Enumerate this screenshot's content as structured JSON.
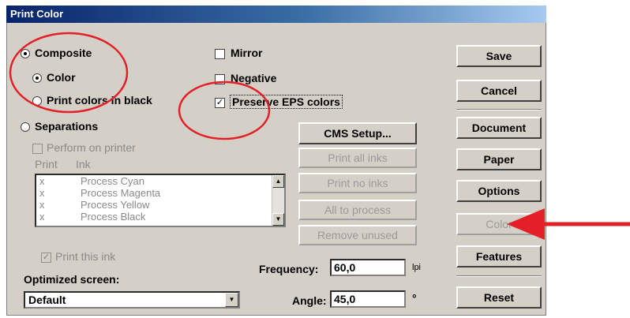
{
  "title": "Print Color",
  "options": {
    "composite": {
      "label": "Composite",
      "selected": true
    },
    "color": {
      "label": "Color",
      "selected": true
    },
    "print_black": {
      "label": "Print colors in black",
      "selected": false
    },
    "separations": {
      "label": "Separations",
      "selected": false
    },
    "perform_on_printer": {
      "label": "Perform on printer",
      "checked": false,
      "enabled": false
    },
    "mirror": {
      "label": "Mirror",
      "checked": false
    },
    "negative": {
      "label": "Negative",
      "checked": false
    },
    "preserve_eps": {
      "label": "Preserve EPS colors",
      "checked": true,
      "mark": "✓"
    }
  },
  "ink_list": {
    "header_print": "Print",
    "header_ink": "Ink",
    "rows": [
      {
        "print": "x",
        "ink": "Process Cyan"
      },
      {
        "print": "x",
        "ink": "Process Magenta"
      },
      {
        "print": "x",
        "ink": "Process Yellow"
      },
      {
        "print": "x",
        "ink": "Process Black"
      }
    ]
  },
  "print_this_ink": {
    "label": "Print this ink",
    "checked": true,
    "mark": "✓"
  },
  "optimized_screen": {
    "label": "Optimized screen:",
    "value": "Default"
  },
  "frequency": {
    "label": "Frequency:",
    "value": "60,0",
    "unit": "lpi"
  },
  "angle": {
    "label": "Angle:",
    "value": "45,0",
    "unit": "°"
  },
  "middle_buttons": {
    "cms_setup": "CMS Setup...",
    "print_all_inks": "Print all inks",
    "print_no_inks": "Print no inks",
    "all_to_process": "All to process",
    "remove_unused": "Remove unused"
  },
  "right_buttons": {
    "save": "Save",
    "cancel": "Cancel",
    "document": "Document",
    "paper": "Paper",
    "options": "Options",
    "color": "Color",
    "features": "Features",
    "reset": "Reset"
  },
  "icons": {
    "scroll_up": "scroll-up-arrow-icon",
    "scroll_down": "scroll-down-arrow-icon",
    "dropdown": "chevron-down-icon"
  },
  "colors": {
    "annotation": "#e32028",
    "titlebar": "#08246b",
    "dialog": "#d4d0c8"
  }
}
